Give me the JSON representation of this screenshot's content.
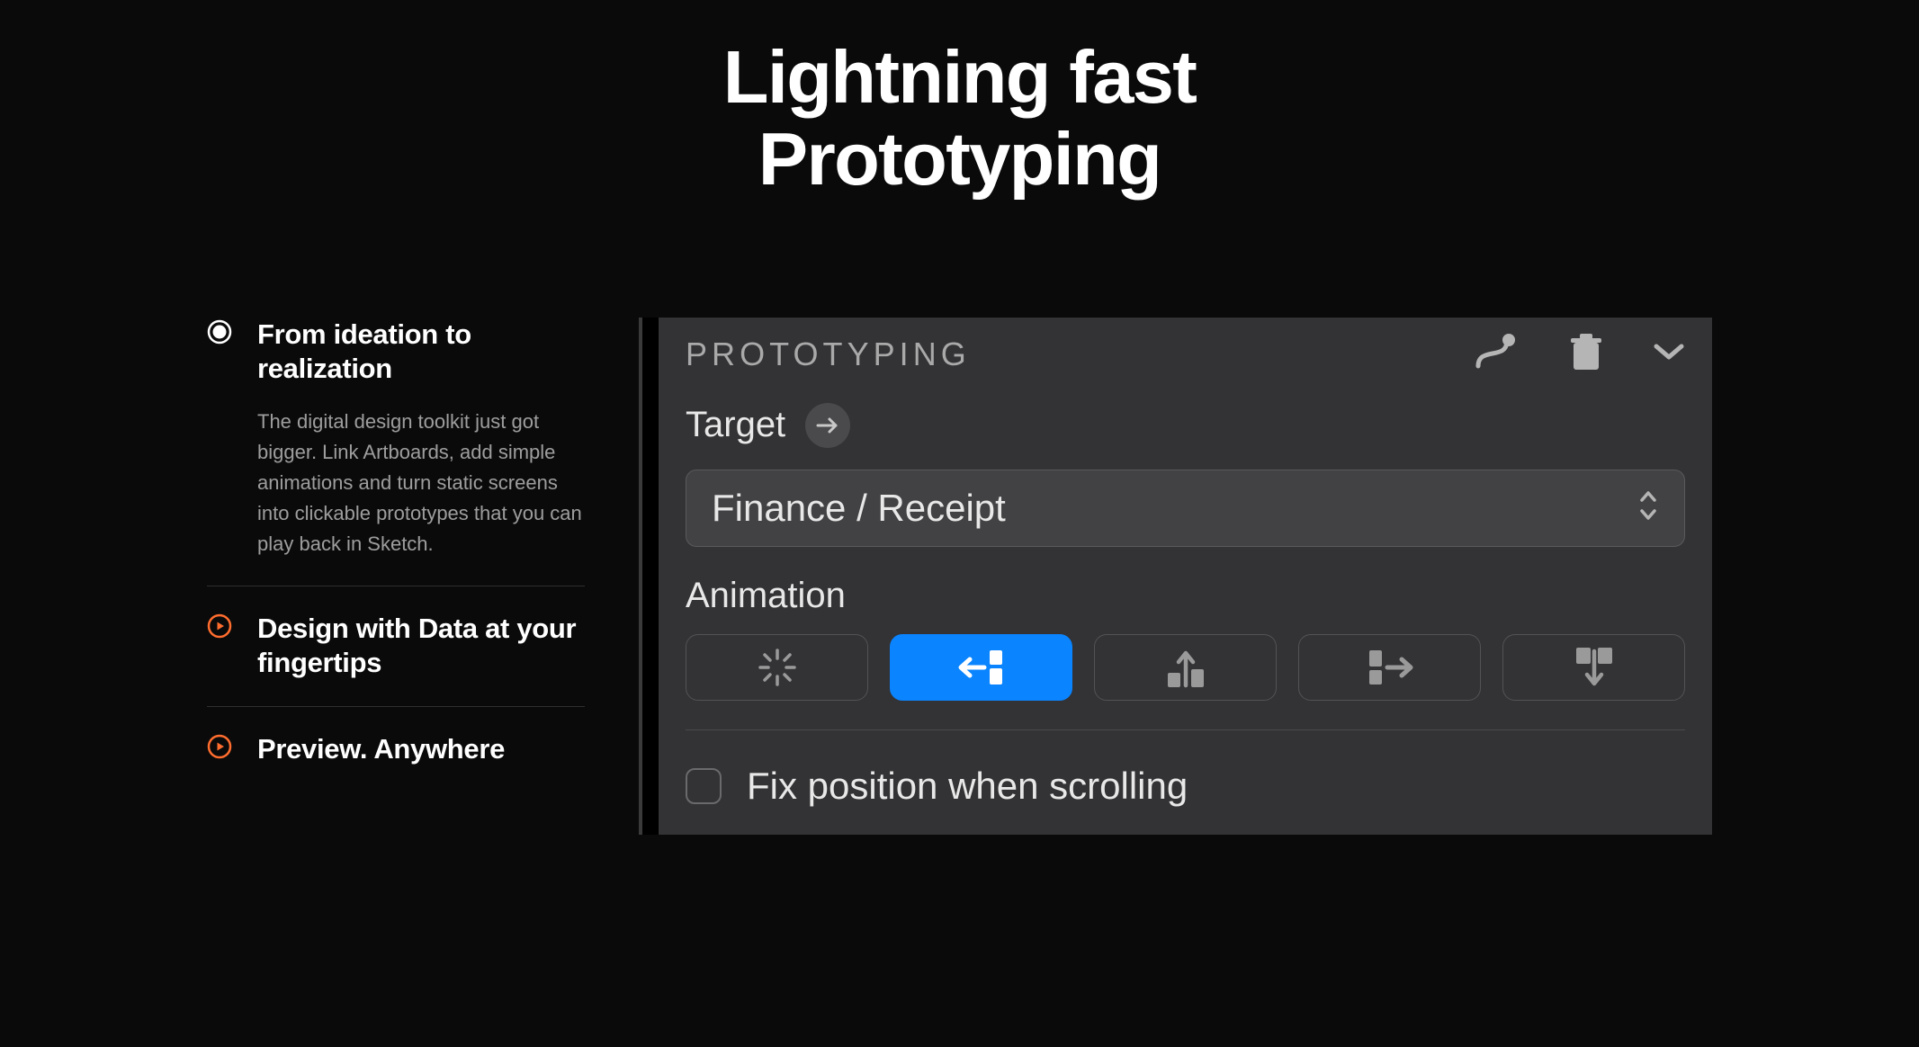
{
  "hero": {
    "line1": "Lightning fast",
    "line2": "Prototyping"
  },
  "features": [
    {
      "title": "From ideation to realization",
      "description": "The digital design toolkit just got bigger. Link Artboards, add simple animations and turn static screens into clickable prototypes that you can play back in Sketch."
    },
    {
      "title": "Design with Data at your fingertips"
    },
    {
      "title": "Preview. Anywhere"
    }
  ],
  "panel": {
    "title": "PROTOTYPING",
    "target_label": "Target",
    "target_value": "Finance / Receipt",
    "animation_label": "Animation",
    "fix_label": "Fix position when scrolling"
  },
  "colors": {
    "accent_blue": "#0a84ff",
    "accent_orange": "#ff6d2e"
  }
}
